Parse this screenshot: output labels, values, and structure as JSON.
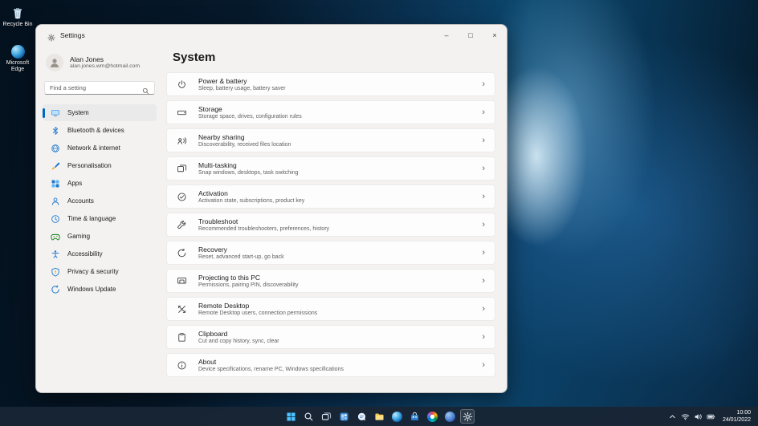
{
  "colors": {
    "accent": "#0067c0",
    "taskbar_bg": "#182535",
    "card_bg": "#fdfdfd",
    "window_bg": "#f3f2f1"
  },
  "desktop": {
    "icons": [
      {
        "name": "recycle-bin",
        "label": "Recycle Bin"
      },
      {
        "name": "microsoft-edge",
        "label": "Microsoft Edge"
      }
    ]
  },
  "window": {
    "titlebar": {
      "title": "Settings",
      "minimize": "–",
      "maximize": "□",
      "close": "×"
    },
    "profile": {
      "name": "Alan Jones",
      "email": "alan.jones.wm@hotmail.com"
    },
    "search": {
      "placeholder": "Find a setting"
    },
    "sidebar": [
      {
        "label": "System",
        "icon": "system-icon",
        "active": true
      },
      {
        "label": "Bluetooth & devices",
        "icon": "bluetooth-icon",
        "active": false
      },
      {
        "label": "Network & internet",
        "icon": "network-icon",
        "active": false
      },
      {
        "label": "Personalisation",
        "icon": "personalisation-icon",
        "active": false
      },
      {
        "label": "Apps",
        "icon": "apps-icon",
        "active": false
      },
      {
        "label": "Accounts",
        "icon": "accounts-icon",
        "active": false
      },
      {
        "label": "Time & language",
        "icon": "time-icon",
        "active": false
      },
      {
        "label": "Gaming",
        "icon": "gaming-icon",
        "active": false
      },
      {
        "label": "Accessibility",
        "icon": "accessibility-icon",
        "active": false
      },
      {
        "label": "Privacy & security",
        "icon": "privacy-icon",
        "active": false
      },
      {
        "label": "Windows Update",
        "icon": "update-icon",
        "active": false
      }
    ],
    "page": {
      "title": "System"
    },
    "chevron": "›",
    "cards": [
      {
        "icon": "power-icon",
        "title": "Power & battery",
        "subtitle": "Sleep, battery usage, battery saver"
      },
      {
        "icon": "storage-icon",
        "title": "Storage",
        "subtitle": "Storage space, drives, configuration rules"
      },
      {
        "icon": "nearby-icon",
        "title": "Nearby sharing",
        "subtitle": "Discoverability, received files location"
      },
      {
        "icon": "multitask-icon",
        "title": "Multi-tasking",
        "subtitle": "Snap windows, desktops, task switching"
      },
      {
        "icon": "activation-icon",
        "title": "Activation",
        "subtitle": "Activation state, subscriptions, product key"
      },
      {
        "icon": "troubleshoot-icon",
        "title": "Troubleshoot",
        "subtitle": "Recommended troubleshooters, preferences, history"
      },
      {
        "icon": "recovery-icon",
        "title": "Recovery",
        "subtitle": "Reset, advanced start-up, go back"
      },
      {
        "icon": "projecting-icon",
        "title": "Projecting to this PC",
        "subtitle": "Permissions, pairing PIN, discoverability"
      },
      {
        "icon": "remote-icon",
        "title": "Remote Desktop",
        "subtitle": "Remote Desktop users, connection permissions"
      },
      {
        "icon": "clipboard-icon",
        "title": "Clipboard",
        "subtitle": "Cut and copy history, sync, clear"
      },
      {
        "icon": "about-icon",
        "title": "About",
        "subtitle": "Device specifications, rename PC, Windows specifications"
      }
    ]
  },
  "taskbar": {
    "icons": [
      "start-icon",
      "tb-search-icon",
      "task-view-icon",
      "widgets-icon",
      "chat-icon",
      "file-explorer-icon",
      "edge-icon",
      "store-icon",
      "photos-icon",
      "app-blue-icon",
      "settings-icon"
    ],
    "active_icon": "settings-icon",
    "tray": {
      "icons": [
        "chevron-up-icon",
        "wifi-icon",
        "volume-icon",
        "battery-icon"
      ],
      "time": "10:00",
      "date": "24/01/2022"
    }
  }
}
